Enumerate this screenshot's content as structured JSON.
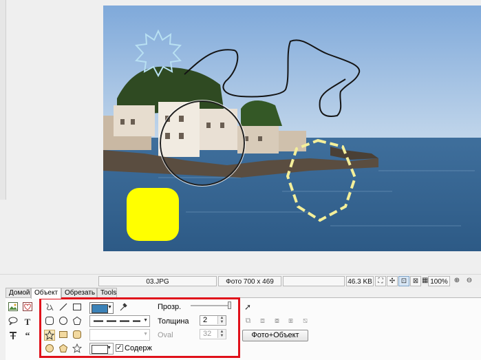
{
  "statusbar": {
    "filename": "03.JPG",
    "image_info": "Фото 700 x 469",
    "file_size": "46.3 KB",
    "zoom": "100%",
    "icons": [
      "fit-icon",
      "expand-icon",
      "zoom-rect-icon",
      "zoom-actual-icon",
      "checker-icon",
      "zoom-in-icon",
      "zoom-out-icon"
    ]
  },
  "tabs": [
    {
      "label": "Домой",
      "active": false
    },
    {
      "label": "Объект",
      "active": true
    },
    {
      "label": "Обрезать",
      "active": false
    },
    {
      "label": "Tools",
      "active": false
    }
  ],
  "ribbon": {
    "opacity_label": "Прозр.",
    "opacity_value": 1.0,
    "thickness_label": "Толщина",
    "thickness_value": "2",
    "oval_label": "Оval",
    "oval_value": "32",
    "content_checkbox_label": "Содержа",
    "content_checked": true,
    "photo_object_button": "Фото+Объект"
  },
  "colors": {
    "stroke_swatch": "#3b82b8",
    "highlight_frame": "#e0101a",
    "yellow_shape": "#ffff00",
    "dashed_shape": "#f4ef9a",
    "star_outline": "#b8e0f2"
  }
}
